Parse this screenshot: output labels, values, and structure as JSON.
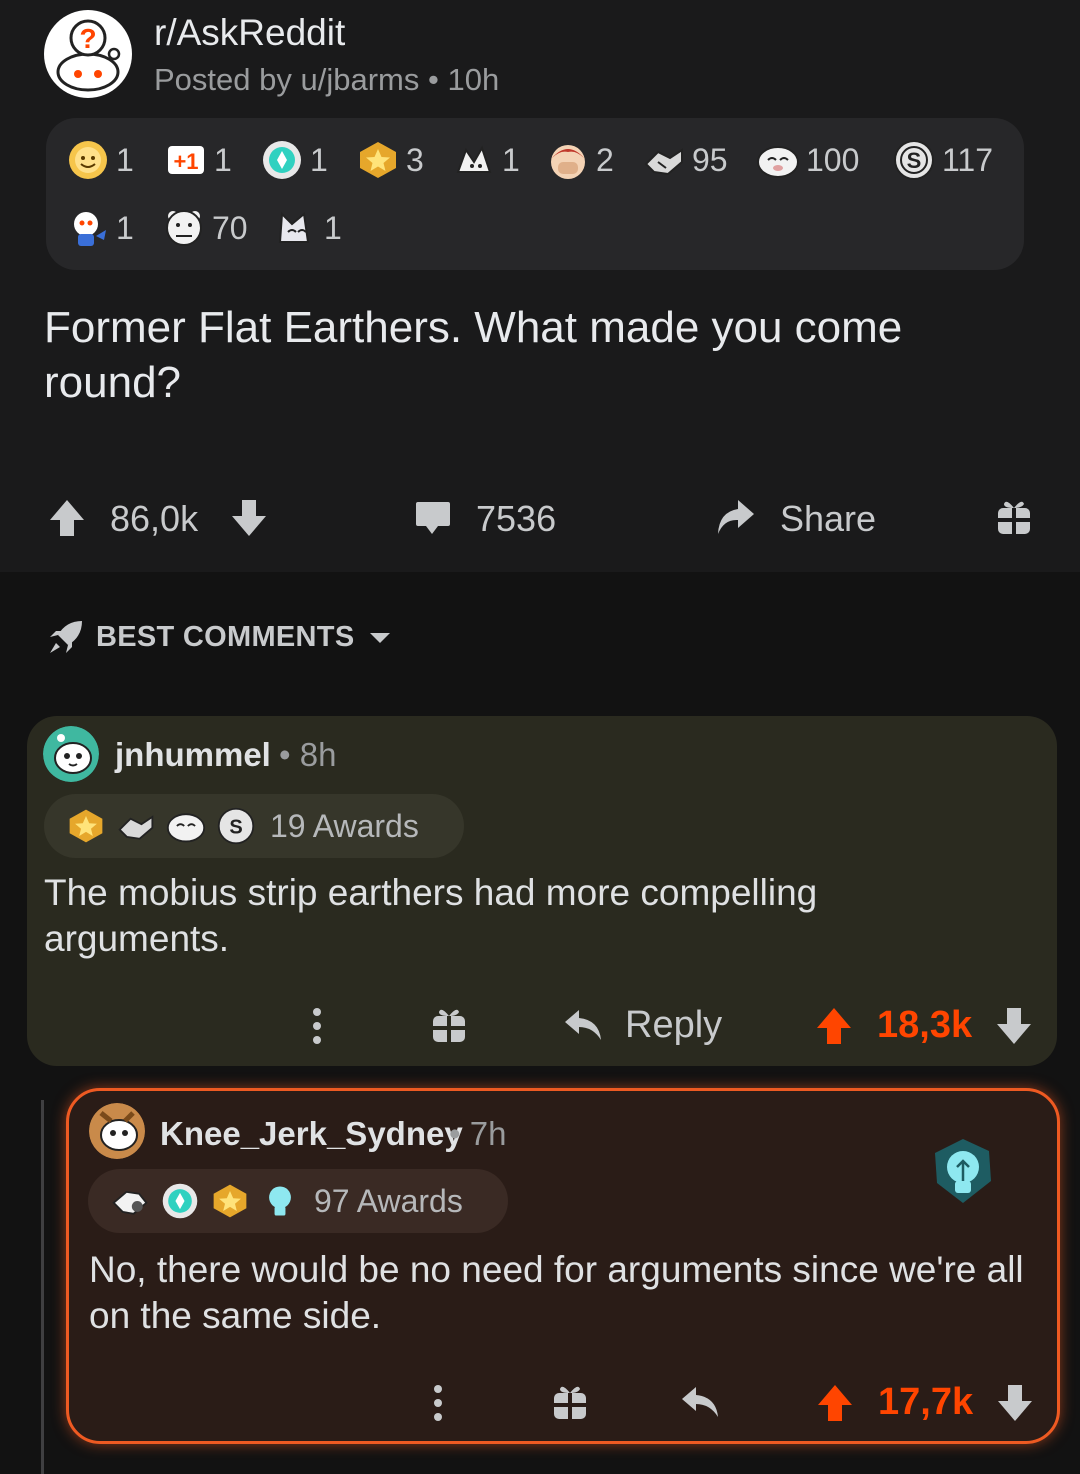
{
  "post": {
    "subreddit": "r/AskReddit",
    "meta_prefix": "Posted by",
    "author": "u/jbarms",
    "age": "10h",
    "awards": [
      {
        "icon": "wholesome-sun-icon",
        "count": "1"
      },
      {
        "icon": "plus-one-icon",
        "count": "1"
      },
      {
        "icon": "platinum-gem-icon",
        "count": "1"
      },
      {
        "icon": "gold-star-icon",
        "count": "3"
      },
      {
        "icon": "doggo-award-icon",
        "count": "1"
      },
      {
        "icon": "facepalm-award-icon",
        "count": "2"
      },
      {
        "icon": "bravo-handshake-icon",
        "count": "95"
      },
      {
        "icon": "laughing-seal-icon",
        "count": "100"
      },
      {
        "icon": "silver-coin-icon",
        "count": "117"
      },
      {
        "icon": "snoo-award-icon",
        "count": "1"
      },
      {
        "icon": "wholesome-bear-icon",
        "count": "1"
      },
      {
        "icon": "cat-award-icon",
        "count": "70"
      }
    ],
    "awards_row2": [
      {
        "icon": "snoo-award-icon",
        "count": "1"
      },
      {
        "icon": "wholesome-bear-icon",
        "count": "70"
      },
      {
        "icon": "cat-award-icon",
        "count": "1"
      }
    ],
    "title": "Former Flat Earthers. What made you come round?",
    "score": "86,0k",
    "comments": "7536",
    "share_label": "Share"
  },
  "sort": {
    "label": "BEST COMMENTS"
  },
  "comments": [
    {
      "username": "jnhummel",
      "age": "8h",
      "awards_label": "19 Awards",
      "award_icons": [
        "gold-star-icon",
        "bravo-handshake-icon",
        "laughing-seal-icon",
        "silver-coin-icon"
      ],
      "body": "The mobius strip earthers had more compelling arguments.",
      "reply_label": "Reply",
      "score": "18,3k"
    },
    {
      "username": "Knee_Jerk_Sydney",
      "age": "7h",
      "awards_label": "97 Awards",
      "award_icons": [
        "helping-hand-icon",
        "platinum-gem-icon",
        "gold-star-icon",
        "lightbulb-icon"
      ],
      "body": "No, there would be no need for arguments since we're all on the same side.",
      "score": "17,7k"
    }
  ],
  "colors": {
    "accent": "#ff4500",
    "post_bg": "#1a1a1b",
    "comment1_bg": "#2a2a1f",
    "comment2_bg": "#2a1c17",
    "comment2_border": "#ee5a22"
  }
}
